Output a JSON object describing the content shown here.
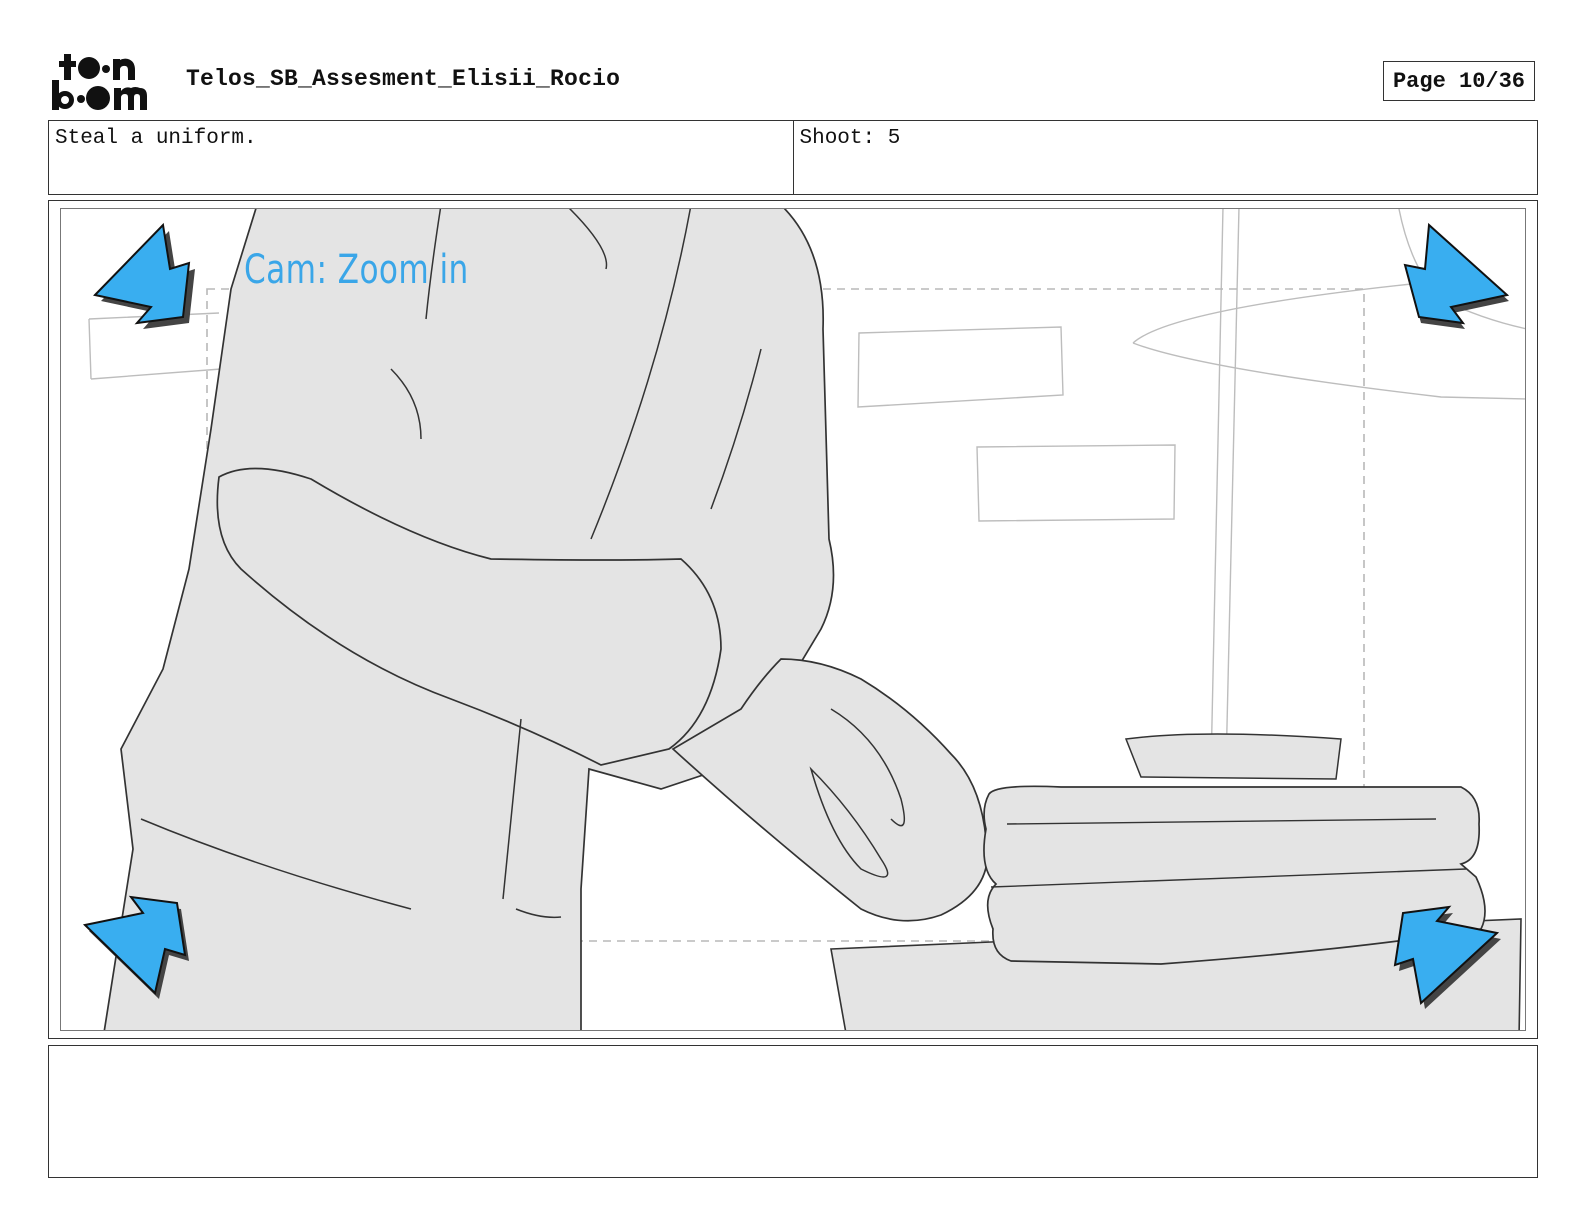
{
  "header": {
    "logo_alt": "toon boom",
    "title": "Telos_SB_Assesment_Elisii_Rocio",
    "page_label": "Page 10/36"
  },
  "panel_info": {
    "action": "Steal a uniform.",
    "shot": "Shoot: 5"
  },
  "panel": {
    "camera_note": "Cam: Zoom in",
    "arrow_color": "#39aef0",
    "sketch_fill": "#e4e4e4",
    "icons": [
      "zoom-arrow-top-left-icon",
      "zoom-arrow-top-right-icon",
      "zoom-arrow-bottom-left-icon",
      "zoom-arrow-bottom-right-icon"
    ]
  },
  "notes": {
    "text": ""
  }
}
